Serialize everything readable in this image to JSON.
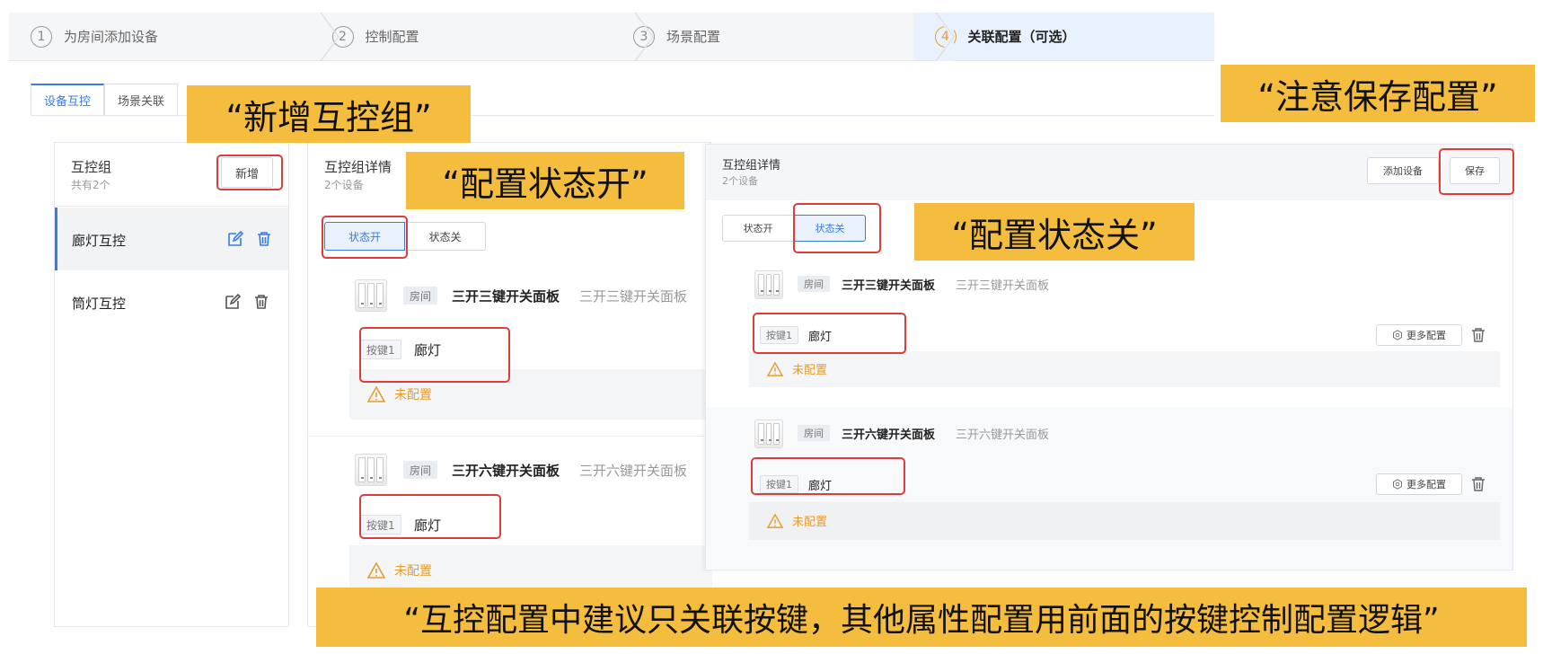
{
  "steps": [
    {
      "num": "1",
      "label": "为房间添加设备"
    },
    {
      "num": "2",
      "label": "控制配置"
    },
    {
      "num": "3",
      "label": "场景配置"
    },
    {
      "num": "4",
      "label": "关联配置（可选）"
    }
  ],
  "tabs": [
    "设备互控",
    "场景关联"
  ],
  "group_list": {
    "title": "互控组",
    "count": "共有2个",
    "add_button": "新增",
    "items": [
      "廊灯互控",
      "筒灯互控"
    ]
  },
  "detail_left": {
    "title": "互控组详情",
    "count": "2个设备",
    "state_on": "状态开",
    "state_off": "状态关",
    "devices": [
      {
        "room": "房间",
        "name": "三开三键开关面板",
        "subname": "三开三键开关面板",
        "key": "按键1",
        "key_label": "廊灯",
        "status": "未配置"
      },
      {
        "room": "房间",
        "name": "三开六键开关面板",
        "subname": "三开六键开关面板",
        "key": "按键1",
        "key_label": "廊灯",
        "status": "未配置"
      }
    ]
  },
  "detail_right": {
    "title": "互控组详情",
    "count": "2个设备",
    "add_device": "添加设备",
    "save": "保存",
    "state_on": "状态开",
    "state_off": "状态关",
    "more_config": "更多配置",
    "devices": [
      {
        "room": "房间",
        "name": "三开三键开关面板",
        "subname": "三开三键开关面板",
        "key": "按键1",
        "key_label": "廊灯",
        "status": "未配置"
      },
      {
        "room": "房间",
        "name": "三开六键开关面板",
        "subname": "三开六键开关面板",
        "key": "按键1",
        "key_label": "廊灯",
        "status": "未配置"
      }
    ]
  },
  "callouts": {
    "add_group": "“新增互控组”",
    "save_note": "“注意保存配置”",
    "state_on": "“配置状态开”",
    "state_off": "“配置状态关”",
    "bottom": "“互控配置中建议只关联按键，其他属性配置用前面的按键控制配置逻辑”"
  },
  "colors": {
    "accent": "#3a7be0",
    "callout": "#f5bd3e",
    "highlight": "#e03b3b",
    "warning": "#e89b2e"
  }
}
